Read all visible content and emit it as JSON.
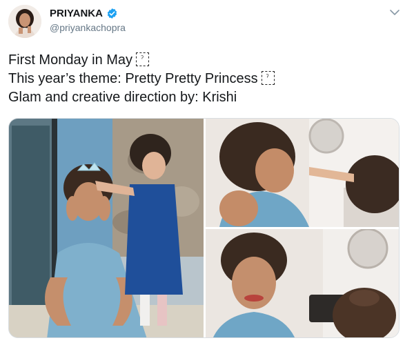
{
  "tweet": {
    "author": {
      "display_name": "PRIYANKA",
      "handle": "@priyankachopra",
      "verified": true,
      "avatar_icon": "profile-photo"
    },
    "menu_icon": "chevron-down-icon",
    "lines": [
      {
        "text": "First Monday in May",
        "emoji": true
      },
      {
        "text": "This year’s theme: Pretty Pretty Princess",
        "emoji": true
      },
      {
        "text": "Glam and creative direction by: Krishi",
        "emoji": false
      }
    ],
    "emoji_glyph": "ˀ",
    "media": [
      {
        "name": "photo-tiara-girl",
        "alt": "woman with tiara and child"
      },
      {
        "name": "photo-makeup",
        "alt": "child applying makeup"
      },
      {
        "name": "photo-smile",
        "alt": "woman smiling"
      }
    ]
  },
  "colors": {
    "text": "#14171a",
    "secondary": "#657786",
    "verified": "#1da1f2",
    "border": "#d8dde1"
  }
}
